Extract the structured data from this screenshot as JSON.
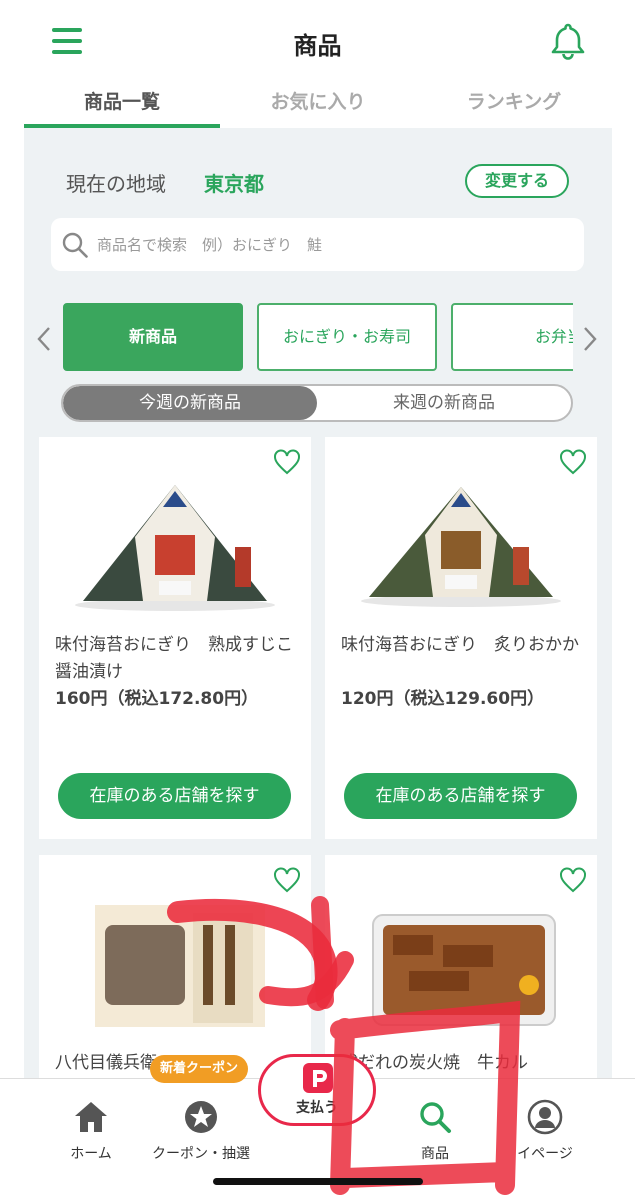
{
  "header": {
    "title": "商品",
    "menu_icon": "hamburger-menu-icon",
    "bell_icon": "bell-icon"
  },
  "tabs": [
    {
      "label": "商品一覧",
      "active": true
    },
    {
      "label": "お気に入り",
      "active": false
    },
    {
      "label": "ランキング",
      "active": false
    }
  ],
  "region": {
    "label": "現在の地域",
    "value": "東京都",
    "change_label": "変更する"
  },
  "search": {
    "placeholder": "商品名で検索　例）おにぎり　鮭"
  },
  "categories": [
    {
      "label": "新商品",
      "active": true
    },
    {
      "label": "おにぎり・お寿司",
      "active": false
    },
    {
      "label": "お弁当",
      "active": false
    }
  ],
  "week_toggle": [
    {
      "label": "今週の新商品",
      "active": true
    },
    {
      "label": "来週の新商品",
      "active": false
    }
  ],
  "products": [
    {
      "name": "味付海苔おにぎり　熟成すじこ醤油漬け",
      "price": "160円（税込172.80円）",
      "button": "在庫のある店舗を探す"
    },
    {
      "name": "味付海苔おにぎり　炙りおかか",
      "price": "120円（税込129.60円）",
      "button": "在庫のある店舗を探す"
    },
    {
      "name": "八代目儀兵衛",
      "price": ""
    },
    {
      "name": "成だれの炭火焼　牛カル",
      "price": ""
    }
  ],
  "bottom_nav": {
    "home": "ホーム",
    "coupon": "クーポン・抽選",
    "coupon_badge": "新着クーポン",
    "pay": "支払う",
    "products": "商品",
    "mypage": "マイページ",
    "mypage_visible": "イページ"
  },
  "colors": {
    "brand_green": "#2aa55c",
    "coupon_orange": "#f19d24",
    "pay_red": "#e8284a",
    "annotation_red": "#ea2b3c"
  }
}
